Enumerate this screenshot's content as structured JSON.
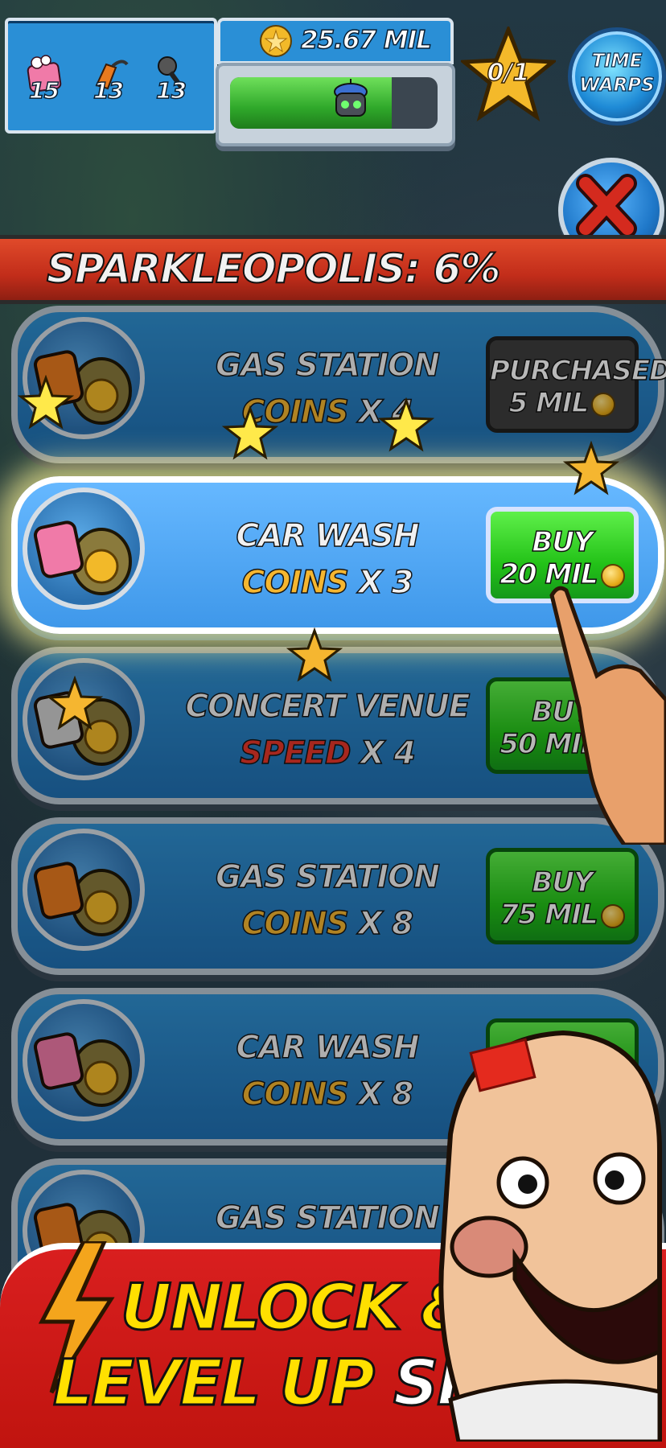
{
  "hud": {
    "resources": [
      {
        "icon": "soap-icon",
        "count": "15"
      },
      {
        "icon": "gas-nozzle-icon",
        "count": "13"
      },
      {
        "icon": "microphone-icon",
        "count": "13"
      }
    ],
    "coins": "25.67 MIL",
    "progress_fraction": 0.78,
    "stars": "0/1",
    "time_warps_line1": "TIME",
    "time_warps_line2": "WARPS"
  },
  "title": "SPARKLEOPOLIS: 6%",
  "shops": [
    {
      "name": "GAS STATION",
      "kind": "COINS",
      "kind_type": "coins",
      "mult": "X 4",
      "state": "purchased",
      "btn_l1": "PURCHASED",
      "btn_l2": "5 MIL",
      "icon": "gas-station-icon",
      "active": false
    },
    {
      "name": "CAR WASH",
      "kind": "COINS",
      "kind_type": "coins",
      "mult": "X 3",
      "state": "buy",
      "btn_l1": "BUY",
      "btn_l2": "20 MIL",
      "icon": "car-wash-icon",
      "active": true
    },
    {
      "name": "CONCERT VENUE",
      "kind": "SPEED",
      "kind_type": "speed",
      "mult": "X 4",
      "state": "buy",
      "btn_l1": "BUY",
      "btn_l2": "50 MIL",
      "icon": "concert-venue-icon",
      "active": false
    },
    {
      "name": "GAS STATION",
      "kind": "COINS",
      "kind_type": "coins",
      "mult": "X 8",
      "state": "buy",
      "btn_l1": "BUY",
      "btn_l2": "75 MIL",
      "icon": "gas-station-icon",
      "active": false
    },
    {
      "name": "CAR WASH",
      "kind": "COINS",
      "kind_type": "coins",
      "mult": "X 8",
      "state": "buy",
      "btn_l1": "BUY",
      "btn_l2": "",
      "icon": "car-wash-icon",
      "active": false
    },
    {
      "name": "GAS STATION",
      "kind": "",
      "kind_type": "coins",
      "mult": "",
      "state": "buy",
      "btn_l1": "",
      "btn_l2": "",
      "icon": "gas-station-icon",
      "active": false
    }
  ],
  "banner": {
    "line1": "UNLOCK &",
    "line2_a": "LEVEL UP",
    "line2_b": "SHOPS"
  },
  "colors": {
    "coins": "#f5b630",
    "speed": "#e8362a",
    "buy_green": "#23c218",
    "banner_red": "#d91f1f",
    "banner_yellow": "#ffe000"
  }
}
